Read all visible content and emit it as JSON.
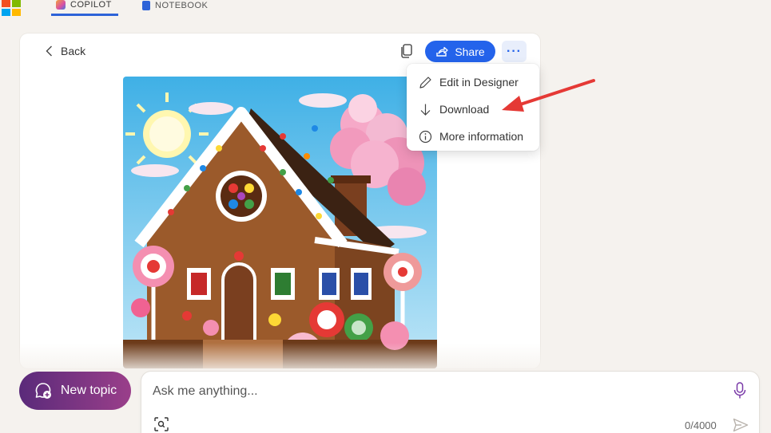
{
  "tabs": [
    {
      "label": "COPILOT",
      "active": true
    },
    {
      "label": "NOTEBOOK",
      "active": false
    }
  ],
  "card": {
    "back_label": "Back",
    "share_label": "Share",
    "more_label": "···"
  },
  "menu": {
    "items": [
      {
        "label": "Edit in Designer",
        "icon": "pencil-icon"
      },
      {
        "label": "Download",
        "icon": "download-icon"
      },
      {
        "label": "More information",
        "icon": "info-icon"
      }
    ]
  },
  "composer": {
    "placeholder": "Ask me anything...",
    "counter": "0/4000"
  },
  "new_topic_label": "New topic",
  "colors": {
    "accent": "#2463eb",
    "new_topic_start": "#5a2a7a",
    "new_topic_end": "#9a3f8a",
    "annotation_arrow": "#e53935"
  }
}
